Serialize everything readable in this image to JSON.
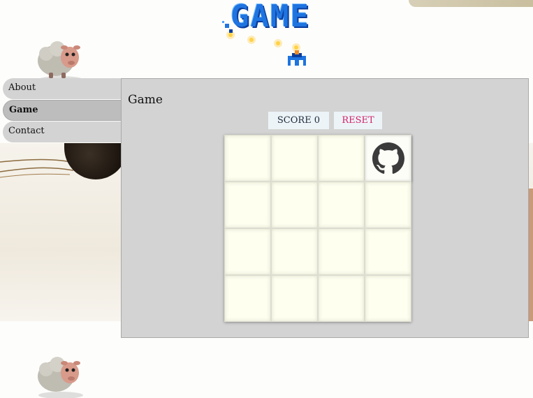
{
  "logo": {
    "title": "GAME"
  },
  "nav": {
    "items": [
      {
        "label": "About",
        "active": false
      },
      {
        "label": "Game",
        "active": true
      },
      {
        "label": "Contact",
        "active": false
      }
    ]
  },
  "panel": {
    "title": "Game",
    "score_label": "SCORE 0",
    "reset_label": "RESET"
  },
  "board": {
    "rows": 4,
    "cols": 4,
    "piece": {
      "icon": "github-icon",
      "row": 0,
      "col": 3
    }
  },
  "colors": {
    "panel_bg": "#d3d3d3",
    "cell_bg": "#fffff0",
    "score_text": "#1c2a3a",
    "reset_text": "#d2226a",
    "logo_blue": "#1f74e0"
  }
}
